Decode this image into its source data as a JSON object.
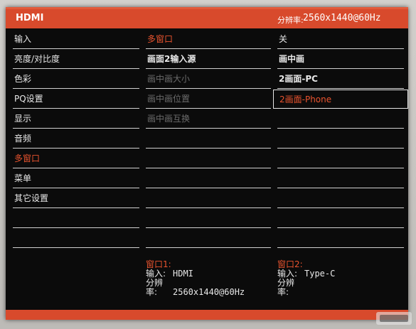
{
  "header": {
    "input_name": "HDMI",
    "resolution_label": "分辨率:",
    "resolution_value": "2560x1440@60Hz"
  },
  "menu_main": [
    {
      "label": "输入",
      "state": "normal"
    },
    {
      "label": "亮度/对比度",
      "state": "normal"
    },
    {
      "label": "色彩",
      "state": "normal"
    },
    {
      "label": "PQ设置",
      "state": "normal"
    },
    {
      "label": "显示",
      "state": "normal"
    },
    {
      "label": "音频",
      "state": "normal"
    },
    {
      "label": "多窗口",
      "state": "active"
    },
    {
      "label": "菜单",
      "state": "normal"
    },
    {
      "label": "其它设置",
      "state": "normal"
    },
    {
      "label": "",
      "state": "normal"
    },
    {
      "label": "",
      "state": "normal"
    }
  ],
  "menu_sub": [
    {
      "label": "多窗口",
      "state": "active"
    },
    {
      "label": "画面2输入源",
      "state": "normal"
    },
    {
      "label": "画中画大小",
      "state": "disabled"
    },
    {
      "label": "画中画位置",
      "state": "disabled"
    },
    {
      "label": "画中画互换",
      "state": "disabled"
    },
    {
      "label": "",
      "state": "normal"
    },
    {
      "label": "",
      "state": "normal"
    },
    {
      "label": "",
      "state": "normal"
    },
    {
      "label": "",
      "state": "normal"
    },
    {
      "label": "",
      "state": "normal"
    },
    {
      "label": "",
      "state": "normal"
    }
  ],
  "menu_options": [
    {
      "label": "关",
      "state": "normal"
    },
    {
      "label": "画中画",
      "state": "normal"
    },
    {
      "label": "2画面-PC",
      "state": "normal"
    },
    {
      "label": "2画面-Phone",
      "state": "selected"
    },
    {
      "label": "",
      "state": "normal"
    },
    {
      "label": "",
      "state": "normal"
    },
    {
      "label": "",
      "state": "normal"
    },
    {
      "label": "",
      "state": "normal"
    },
    {
      "label": "",
      "state": "normal"
    },
    {
      "label": "",
      "state": "normal"
    },
    {
      "label": "",
      "state": "normal"
    }
  ],
  "window1": {
    "title": "窗口1:",
    "input_label": "输入:",
    "input_value": "HDMI",
    "res_label": "分辨率:",
    "res_value": "2560x1440@60Hz"
  },
  "window2": {
    "title": "窗口2:",
    "input_label": "输入:",
    "input_value": "Type-C",
    "res_label": "分辨率:",
    "res_value": ""
  },
  "colors": {
    "accent": "#d84a2c",
    "active_text": "#e8532e",
    "disabled_text": "#6b6b6b"
  }
}
